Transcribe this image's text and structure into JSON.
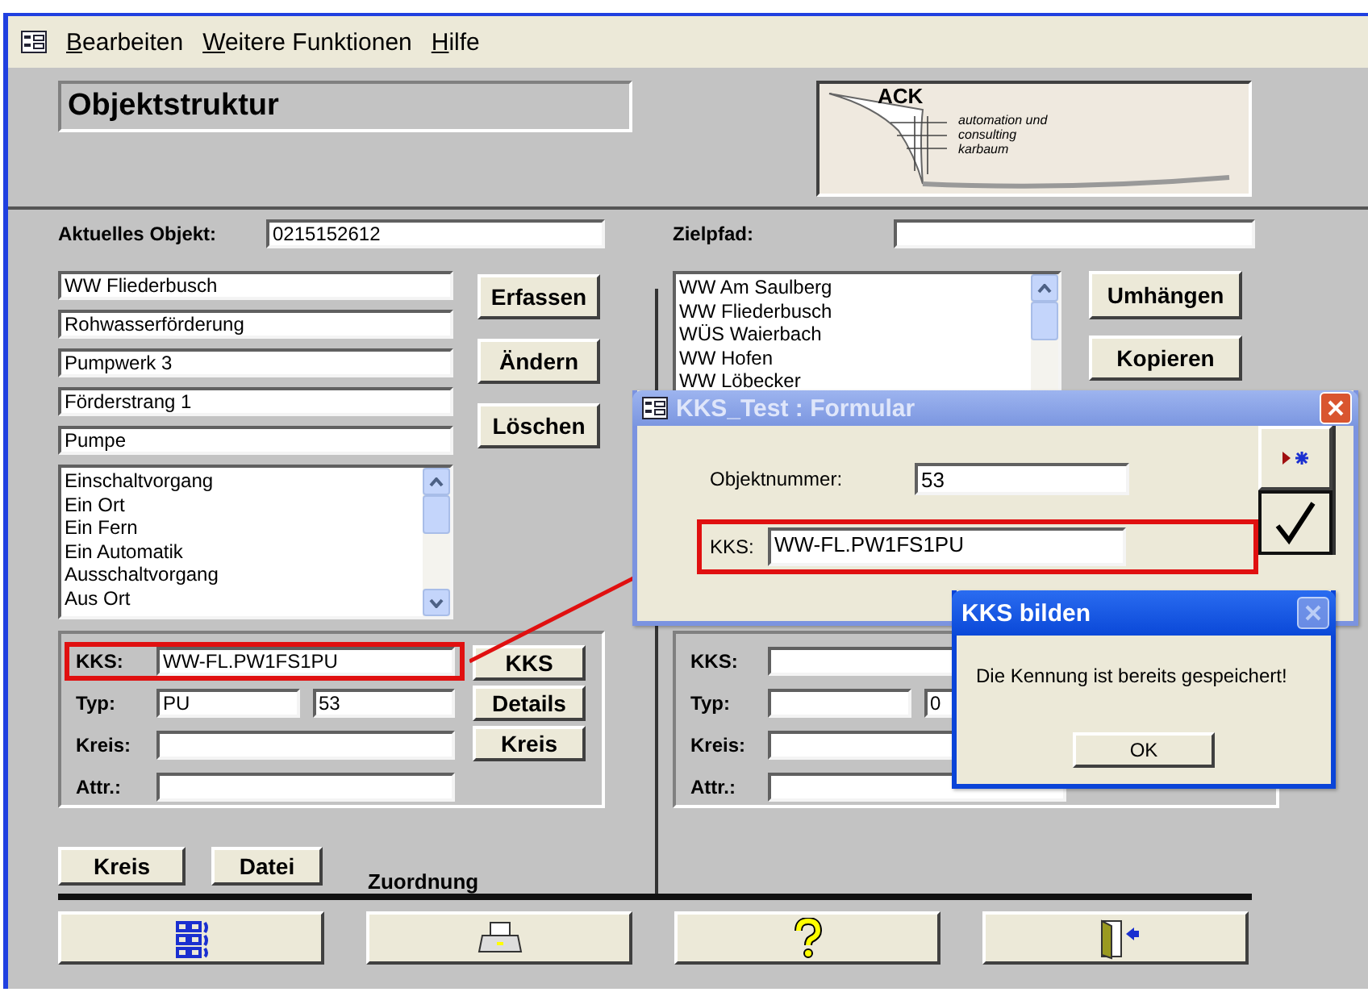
{
  "menu": [
    {
      "label": "Bearbeiten"
    },
    {
      "label": "Weitere Funktionen"
    },
    {
      "label": "Hilfe"
    }
  ],
  "header": {
    "title": "Objektstruktur",
    "logo": {
      "mark": "ACK",
      "lines": [
        "automation und",
        "consulting",
        "karbaum"
      ]
    }
  },
  "left": {
    "current_object": {
      "label": "Aktuelles Objekt:",
      "value": "0215152612"
    },
    "path_fields": [
      "WW Fliederbusch",
      "Rohwasserförderung",
      "Pumpwerk 3",
      "Förderstrang 1",
      "Pumpe"
    ],
    "actions": [
      "Erfassen",
      "Ändern",
      "Löschen"
    ],
    "list": {
      "items": [
        "Einschaltvorgang",
        "Ein Ort",
        "Ein Fern",
        "Ein Automatik",
        "Ausschaltvorgang",
        "Aus Ort"
      ]
    },
    "group": {
      "rows": [
        {
          "label": "KKS:",
          "highlighted": true,
          "fields": [
            {
              "kind": "input",
              "value": "WW-FL.PW1FS1PU"
            }
          ]
        },
        {
          "label": "Typ:",
          "highlighted": false,
          "fields": [
            {
              "kind": "input",
              "value": "PU"
            },
            {
              "kind": "input",
              "value": "53"
            }
          ]
        },
        {
          "label": "Kreis:",
          "highlighted": false,
          "fields": [
            {
              "kind": "input"
            }
          ]
        },
        {
          "label": "Attr.:",
          "highlighted": false,
          "fields": [
            {
              "kind": "input"
            }
          ]
        }
      ],
      "buttons": [
        "KKS",
        "Details",
        "Kreis"
      ]
    },
    "bottom_buttons": [
      "Kreis",
      "Datei"
    ],
    "caption": "Zuordnung"
  },
  "right": {
    "target_path": {
      "label": "Zielpfad:"
    },
    "list": {
      "items": [
        "WW Am Saulberg",
        "WW Fliederbusch",
        "WÜS Waierbach",
        "WW Hofen",
        "WW Löbecker"
      ]
    },
    "actions": [
      "Umhängen",
      "Kopieren"
    ],
    "group": {
      "rows": [
        {
          "label": "KKS:",
          "highlighted": false,
          "fields": [
            {
              "kind": "input"
            }
          ]
        },
        {
          "label": "Typ:",
          "highlighted": false,
          "fields": [
            {
              "kind": "input"
            },
            {
              "kind": "input",
              "value": "0"
            }
          ]
        },
        {
          "label": "Kreis:",
          "highlighted": false,
          "fields": [
            {
              "kind": "input"
            }
          ]
        },
        {
          "label": "Attr.:",
          "highlighted": false,
          "fields": [
            {
              "kind": "input"
            }
          ]
        }
      ]
    }
  },
  "toolbar": [
    {
      "kind": "grid"
    },
    {
      "kind": "print"
    },
    {
      "kind": "help"
    },
    {
      "kind": "exit"
    }
  ],
  "dialogs": [
    {
      "kind": "form",
      "title": "KKS_Test : Formular",
      "active": false,
      "close_disabled": false,
      "fields": [
        {
          "label": "Objektnummer:",
          "value": "53",
          "highlighted": false
        },
        {
          "label": "KKS:",
          "value": "WW-FL.PW1FS1PU",
          "highlighted": true
        }
      ],
      "buttons": [
        {
          "kind": "new-record"
        },
        {
          "kind": "confirm"
        }
      ]
    },
    {
      "kind": "message",
      "title": "KKS bilden",
      "active": true,
      "close_disabled": true,
      "message": "Die Kennung ist bereits gespeichert!",
      "buttons": [
        {
          "label": "OK"
        }
      ]
    }
  ]
}
